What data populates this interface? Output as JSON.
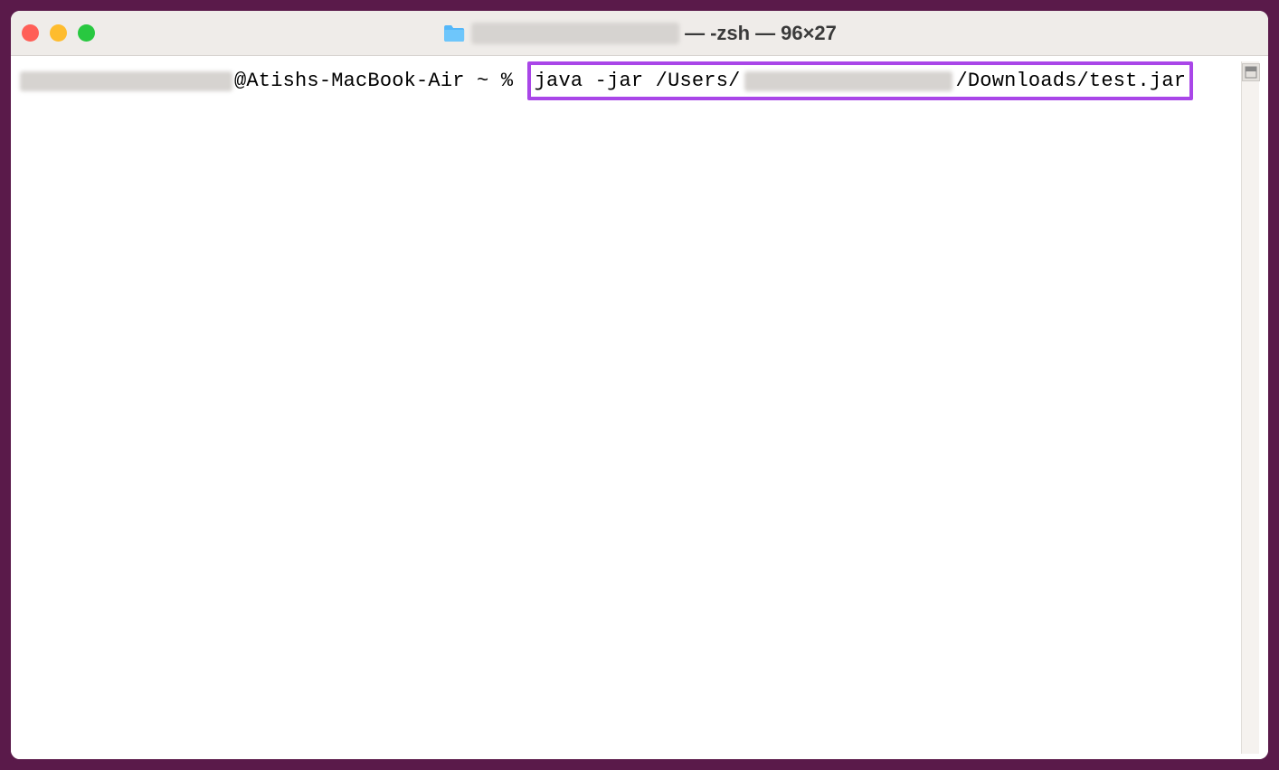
{
  "titlebar": {
    "title_sep1": " — ",
    "shell": "-zsh",
    "title_sep2": " — ",
    "dimensions": "96×27"
  },
  "prompt": {
    "host_part": "@Atishs-MacBook-Air ~ % ",
    "cmd_part1": "java -jar /Users/",
    "cmd_part2": "/Downloads/test.jar"
  },
  "colors": {
    "outer_border": "#5a1a4a",
    "highlight": "#a946e8"
  }
}
